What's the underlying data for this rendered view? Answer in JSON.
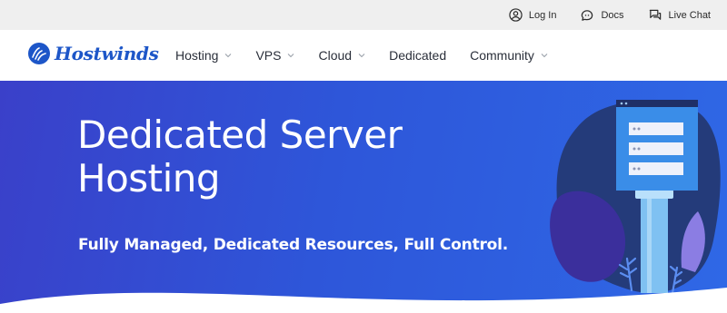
{
  "topbar": {
    "login": {
      "label": "Log In",
      "icon": "user-circle-icon"
    },
    "docs": {
      "label": "Docs",
      "icon": "chat-bubble-icon"
    },
    "livechat": {
      "label": "Live Chat",
      "icon": "conversation-icon"
    }
  },
  "brand": {
    "name": "Hostwinds",
    "logo_icon": "hostwinds-logo-icon",
    "color": "#1d56c8"
  },
  "nav": {
    "items": [
      {
        "label": "Hosting",
        "has_dropdown": true
      },
      {
        "label": "VPS",
        "has_dropdown": true
      },
      {
        "label": "Cloud",
        "has_dropdown": true
      },
      {
        "label": "Dedicated",
        "has_dropdown": false
      },
      {
        "label": "Community",
        "has_dropdown": true
      }
    ]
  },
  "hero": {
    "title": "Dedicated Server Hosting",
    "subtitle": "Fully Managed, Dedicated Resources, Full Control.",
    "illustration": "server-rack-illustration",
    "colors": {
      "gradient_start": "#3a40c9",
      "gradient_end": "#2f68e6",
      "text": "#ffffff"
    }
  }
}
